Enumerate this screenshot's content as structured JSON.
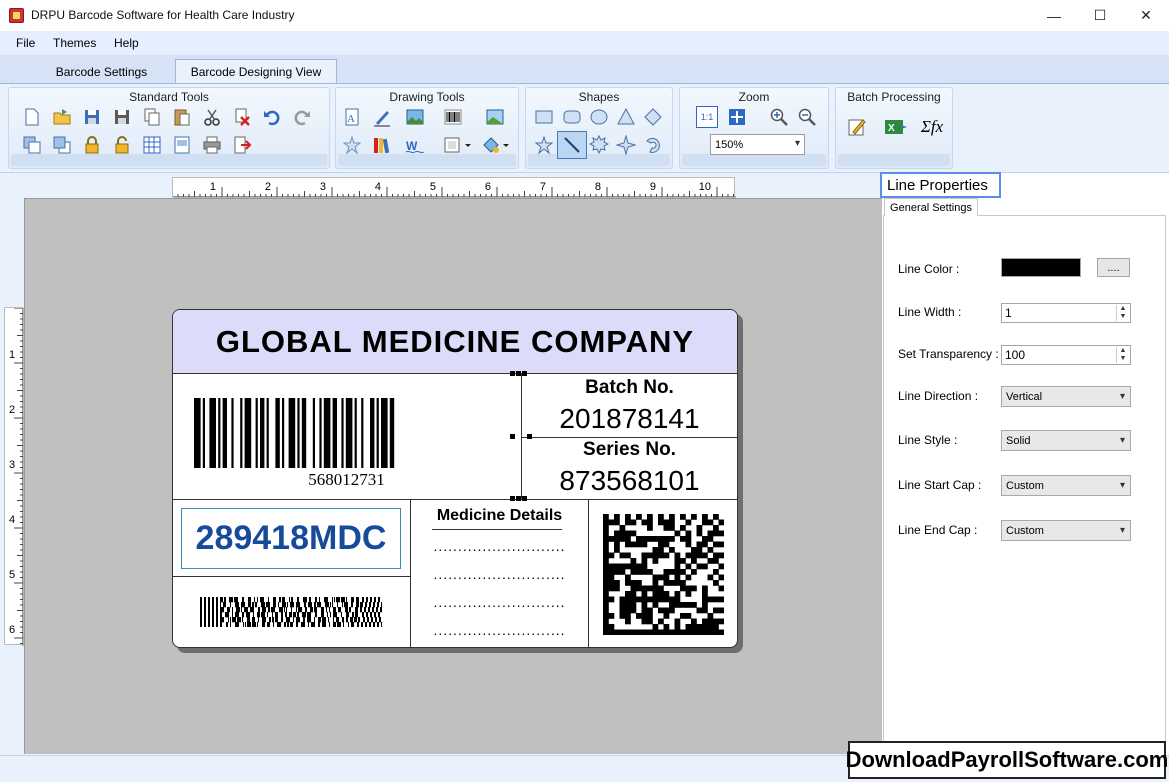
{
  "window": {
    "title": "DRPU Barcode Software for Health Care Industry",
    "controls": {
      "minimize": "—",
      "maximize": "☐",
      "close": "✕"
    }
  },
  "menu": [
    "File",
    "Themes",
    "Help"
  ],
  "tabs": [
    {
      "label": "Barcode Settings",
      "active": false
    },
    {
      "label": "Barcode Designing View",
      "active": true
    }
  ],
  "ribbon": {
    "groups": {
      "standard": "Standard Tools",
      "drawing": "Drawing Tools",
      "shapes": "Shapes",
      "zoom": "Zoom",
      "batch": "Batch Processing"
    },
    "zoom_level": "150%",
    "zoom_one_to_one": "1:1",
    "batch_formula": "Σfx"
  },
  "rulers": {
    "horizontal_ticks": [
      "1",
      "2",
      "3",
      "4",
      "5",
      "6",
      "7",
      "8",
      "9",
      "10"
    ],
    "vertical_ticks": [
      "1",
      "2",
      "3",
      "4",
      "5",
      "6"
    ]
  },
  "label": {
    "company": "GLOBAL MEDICINE COMPANY",
    "barcode_number": "568012731",
    "batch_title": "Batch No.",
    "batch_value": "201878141",
    "series_title": "Series No.",
    "series_value": "873568101",
    "code_text": "289418MDC",
    "details_title": "Medicine Details",
    "dotted_lines": [
      "...........................",
      "...........................",
      "...........................",
      "..........................."
    ]
  },
  "properties": {
    "title": "Line Properties",
    "tab": "General Settings",
    "fields": {
      "line_color": {
        "label": "Line Color :",
        "value": "#000000",
        "button": "...."
      },
      "line_width": {
        "label": "Line Width :",
        "value": "1"
      },
      "transparency": {
        "label": "Set Transparency :",
        "value": "100"
      },
      "direction": {
        "label": "Line Direction :",
        "value": "Vertical"
      },
      "style": {
        "label": "Line Style :",
        "value": "Solid"
      },
      "start_cap": {
        "label": "Line Start Cap :",
        "value": "Custom"
      },
      "end_cap": {
        "label": "Line End Cap :",
        "value": "Custom"
      }
    }
  },
  "watermark": "DownloadPayrollSoftware.com"
}
